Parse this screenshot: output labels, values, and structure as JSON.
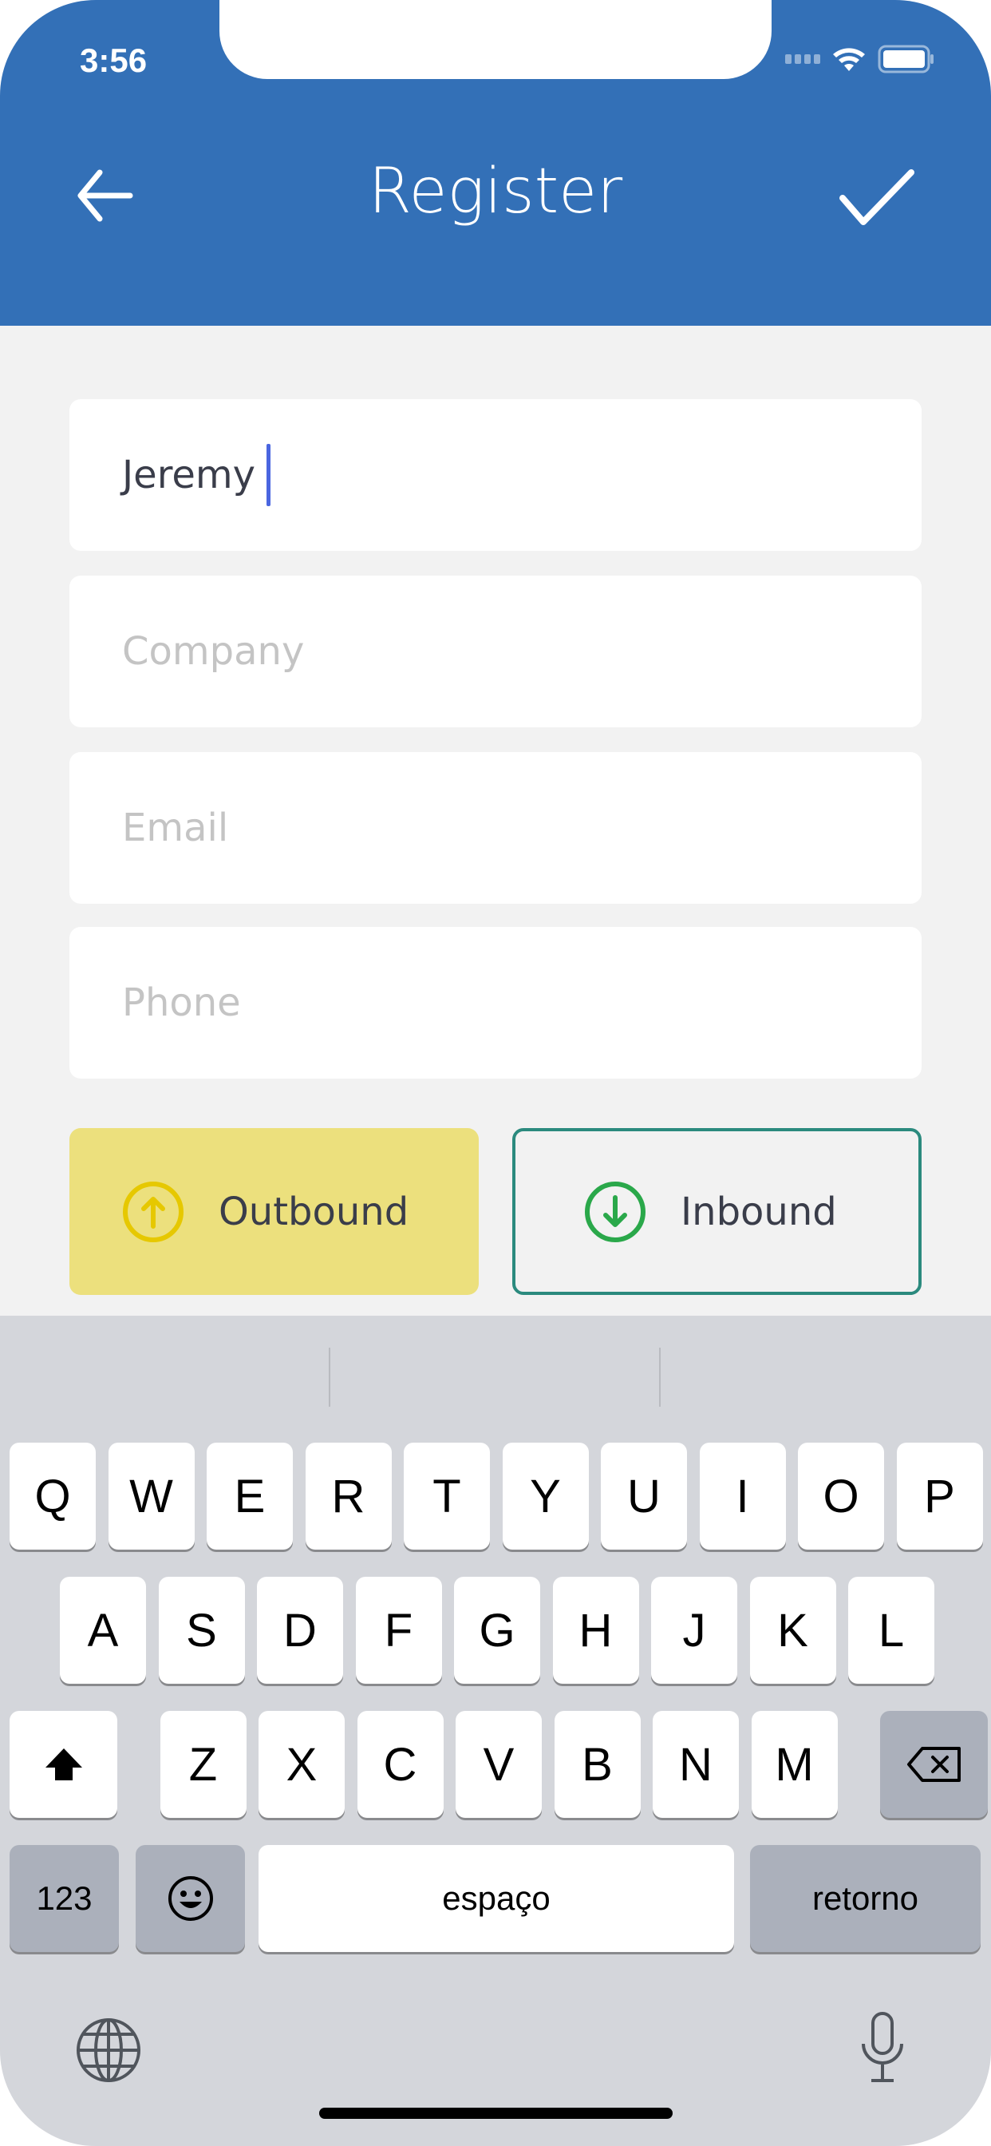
{
  "status_bar": {
    "time": "3:56"
  },
  "header": {
    "title": "Register",
    "back_icon": "arrow-left-icon",
    "confirm_icon": "checkmark-icon"
  },
  "form": {
    "name": {
      "value": "Jeremy"
    },
    "company": {
      "placeholder": "Company"
    },
    "email": {
      "placeholder": "Email"
    },
    "phone": {
      "placeholder": "Phone"
    }
  },
  "direction": {
    "outbound": {
      "label": "Outbound",
      "selected": true,
      "color": "#ece07d",
      "icon_color": "#e6c800"
    },
    "inbound": {
      "label": "Inbound",
      "selected": false,
      "border_color": "#2b8a7e",
      "icon_color": "#2aa84a"
    }
  },
  "keyboard": {
    "row1": [
      "Q",
      "W",
      "E",
      "R",
      "T",
      "Y",
      "U",
      "I",
      "O",
      "P"
    ],
    "row2": [
      "A",
      "S",
      "D",
      "F",
      "G",
      "H",
      "J",
      "K",
      "L"
    ],
    "row3": [
      "Z",
      "X",
      "C",
      "V",
      "B",
      "N",
      "M"
    ],
    "numbers": "123",
    "space": "espaço",
    "return": "retorno"
  },
  "colors": {
    "header": "#3370b7",
    "background": "#f2f2f2",
    "keyboard": "#d4d6db"
  }
}
